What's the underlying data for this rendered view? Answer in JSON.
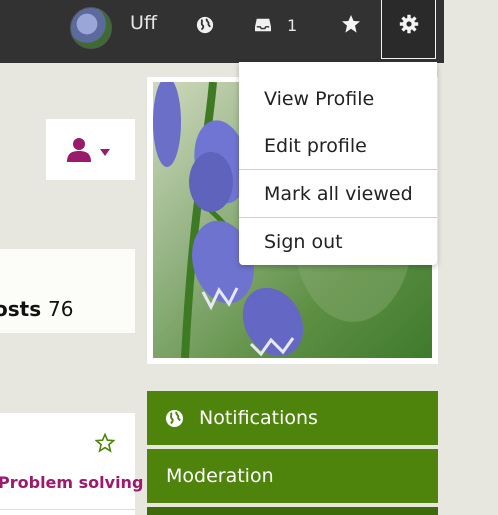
{
  "topbar": {
    "username": "Uff",
    "inbox_count": "1"
  },
  "dropdown": {
    "items": [
      "View Profile",
      "Edit profile",
      "Mark all viewed",
      "Sign out"
    ]
  },
  "stats": {
    "posts_label": "osts",
    "posts_count": "76"
  },
  "topic": {
    "link_text": "Problem solving"
  },
  "nav": {
    "notifications": "Notifications",
    "moderation": "Moderation"
  },
  "colors": {
    "topbar": "#323232",
    "nav_green": "#4f840c",
    "accent_magenta": "#9a1a6e",
    "page_bg": "#e8e7df"
  },
  "icons": {
    "globe": "globe-icon",
    "inbox": "inbox-icon",
    "star": "star-icon",
    "gear": "gear-icon",
    "user": "user-icon",
    "caret": "caret-down-icon"
  }
}
